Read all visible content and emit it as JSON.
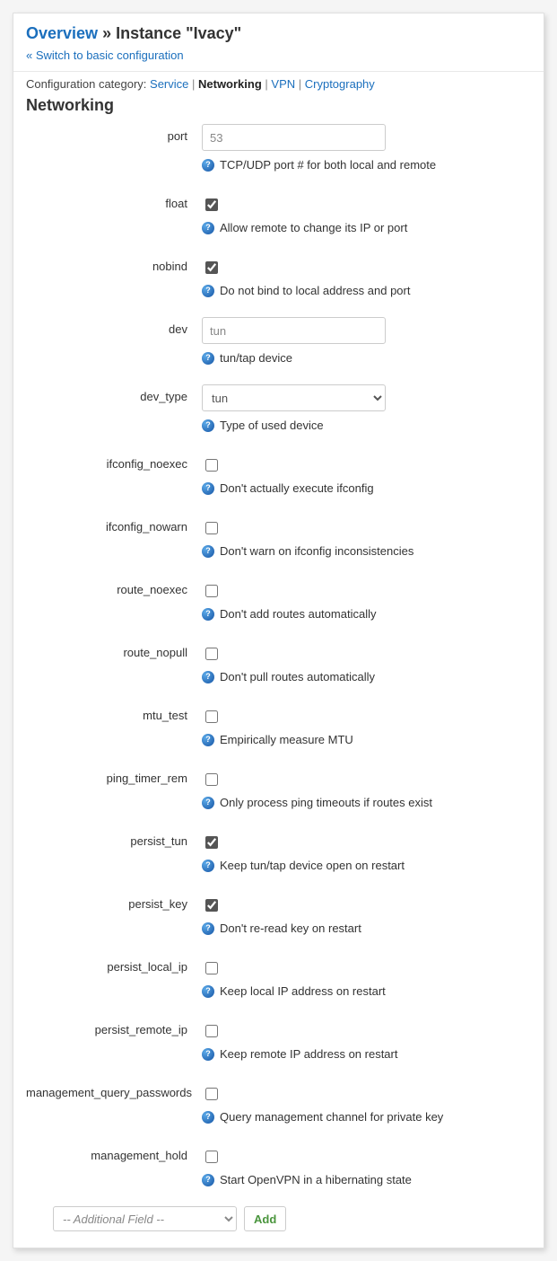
{
  "breadcrumb": {
    "overview": "Overview",
    "sep": " » ",
    "current": "Instance \"Ivacy\""
  },
  "switch_link": "« Switch to basic configuration",
  "category_row": {
    "label": "Configuration category: ",
    "items": [
      "Service",
      "Networking",
      "VPN",
      "Cryptography"
    ],
    "active_index": 1
  },
  "section_title": "Networking",
  "rows": [
    {
      "key": "port",
      "type": "text",
      "value": "53",
      "help": "TCP/UDP port # for both local and remote"
    },
    {
      "key": "float",
      "type": "checkbox",
      "checked": true,
      "help": "Allow remote to change its IP or port"
    },
    {
      "key": "nobind",
      "type": "checkbox",
      "checked": true,
      "help": "Do not bind to local address and port"
    },
    {
      "key": "dev",
      "type": "text",
      "value": "tun",
      "help": "tun/tap device"
    },
    {
      "key": "dev_type",
      "type": "select",
      "value": "tun",
      "help": "Type of used device"
    },
    {
      "key": "ifconfig_noexec",
      "type": "checkbox",
      "checked": false,
      "help": "Don't actually execute ifconfig"
    },
    {
      "key": "ifconfig_nowarn",
      "type": "checkbox",
      "checked": false,
      "help": "Don't warn on ifconfig inconsistencies"
    },
    {
      "key": "route_noexec",
      "type": "checkbox",
      "checked": false,
      "help": "Don't add routes automatically"
    },
    {
      "key": "route_nopull",
      "type": "checkbox",
      "checked": false,
      "help": "Don't pull routes automatically"
    },
    {
      "key": "mtu_test",
      "type": "checkbox",
      "checked": false,
      "help": "Empirically measure MTU"
    },
    {
      "key": "ping_timer_rem",
      "type": "checkbox",
      "checked": false,
      "help": "Only process ping timeouts if routes exist"
    },
    {
      "key": "persist_tun",
      "type": "checkbox",
      "checked": true,
      "help": "Keep tun/tap device open on restart"
    },
    {
      "key": "persist_key",
      "type": "checkbox",
      "checked": true,
      "help": "Don't re-read key on restart"
    },
    {
      "key": "persist_local_ip",
      "type": "checkbox",
      "checked": false,
      "help": "Keep local IP address on restart"
    },
    {
      "key": "persist_remote_ip",
      "type": "checkbox",
      "checked": false,
      "help": "Keep remote IP address on restart"
    },
    {
      "key": "management_query_passwords",
      "type": "checkbox",
      "checked": false,
      "help": "Query management channel for private key"
    },
    {
      "key": "management_hold",
      "type": "checkbox",
      "checked": false,
      "help": "Start OpenVPN in a hibernating state"
    }
  ],
  "footer": {
    "placeholder": "-- Additional Field --",
    "add_label": "Add"
  }
}
